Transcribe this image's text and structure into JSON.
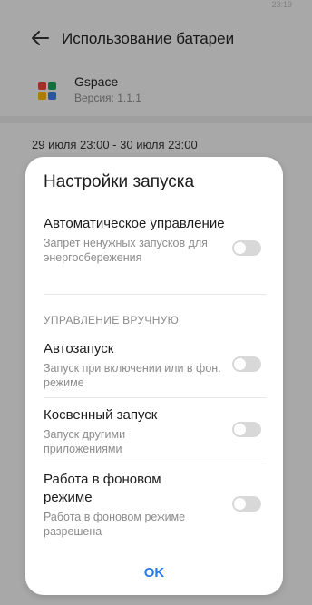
{
  "status": {
    "time": "23:19"
  },
  "header": {
    "title": "Использование батареи",
    "back_icon": "back-arrow-icon"
  },
  "app": {
    "name": "Gspace",
    "version": "Версия: 1.1.1"
  },
  "period": "29 июля 23:00 - 30 июля 23:00",
  "dialog": {
    "title": "Настройки запуска",
    "auto": {
      "title": "Автоматическое управление",
      "subtitle": "Запрет ненужных запусков для энергосбережения",
      "enabled": false
    },
    "manual_section": "УПРАВЛЕНИЕ ВРУЧНУЮ",
    "items": [
      {
        "title": "Автозапуск",
        "subtitle": "Запуск при включении или в фон. режиме",
        "enabled": false
      },
      {
        "title": "Косвенный запуск",
        "subtitle": "Запуск другими приложениями",
        "enabled": false
      },
      {
        "title": "Работа в фоновом режиме",
        "subtitle": "Работа в фоновом режиме разрешена",
        "enabled": false
      }
    ],
    "ok_label": "OK"
  },
  "colors": {
    "accent": "#2a7ae2",
    "toggle_off": "#d8d8d8"
  }
}
